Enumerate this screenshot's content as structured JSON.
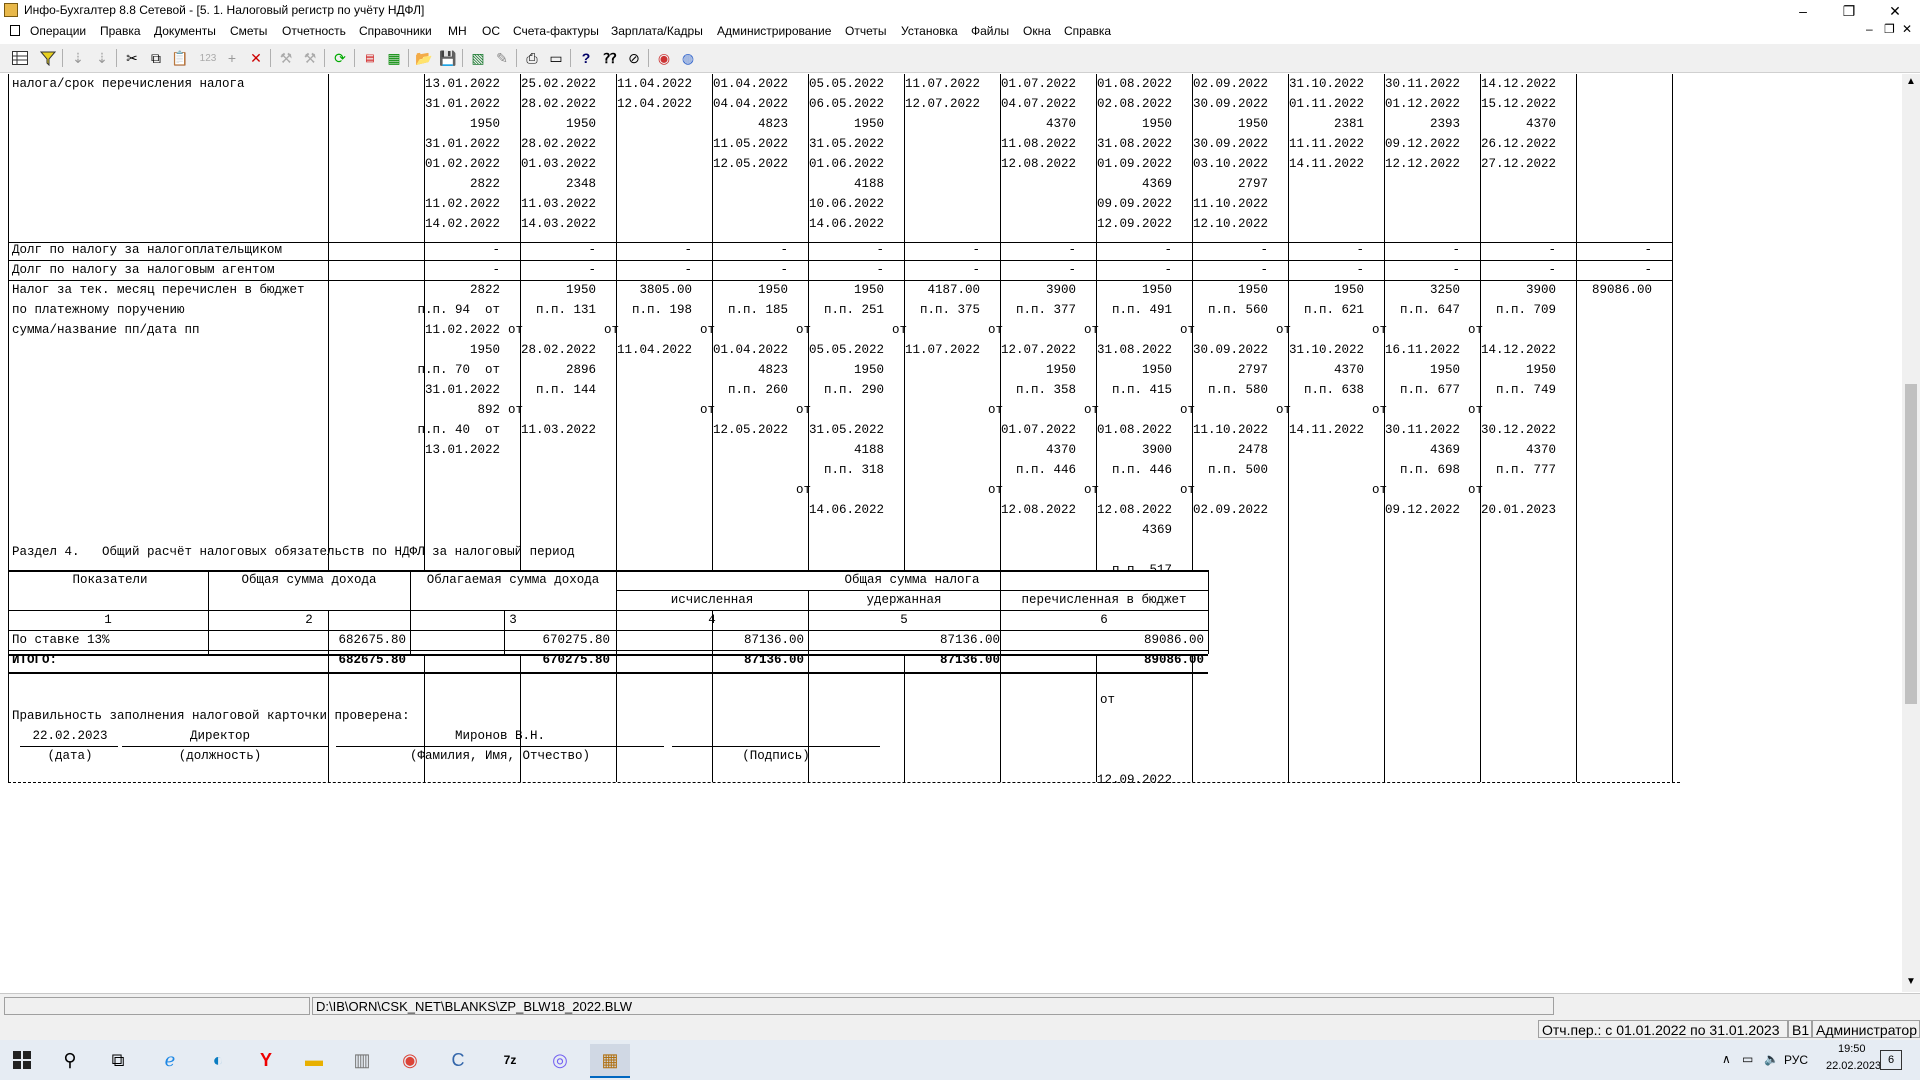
{
  "window": {
    "title": "Инфо-Бухгалтер 8.8 Сетевой - [5. 1. Налоговый регистр по учёту НДФЛ]",
    "min": "–",
    "max": "❐",
    "close": "✕"
  },
  "menu": [
    "Операции",
    "Правка",
    "Документы",
    "Сметы",
    "Отчетность",
    "Справочники",
    "МН",
    "ОС",
    "Счета-фактуры",
    "Зарплата/Кадры",
    "Администрирование",
    "Отчеты",
    "Установка",
    "Файлы",
    "Окна",
    "Справка"
  ],
  "toolbar_icons": [
    "grid-icon",
    "filter-icon",
    "sort-asc-icon",
    "sort-desc-icon",
    "cut-icon",
    "copy-icon",
    "paste-icon",
    "numbering-icon",
    "add-icon",
    "delete-icon",
    "tool-icon",
    "tool2-icon",
    "refresh-icon",
    "pdf-icon",
    "calculator-icon",
    "open-folder-icon",
    "save-icon",
    "excel-icon",
    "edit-icon",
    "print-icon",
    "preview-icon",
    "help-icon",
    "context-help-icon",
    "compass-icon",
    "chrome-icon",
    "web-icon"
  ],
  "doc": {
    "row_due_label": "налога/срок перечисления налога",
    "due_columns": [
      [
        "13.01.2022",
        "31.01.2022",
        "1950",
        "31.01.2022",
        "01.02.2022",
        "2822",
        "11.02.2022",
        "14.02.2022"
      ],
      [
        "25.02.2022",
        "28.02.2022",
        "1950",
        "28.02.2022",
        "01.03.2022",
        "2348",
        "11.03.2022",
        "14.03.2022"
      ],
      [
        "11.04.2022",
        "12.04.2022"
      ],
      [
        "01.04.2022",
        "04.04.2022",
        "4823",
        "11.05.2022",
        "12.05.2022"
      ],
      [
        "05.05.2022",
        "06.05.2022",
        "1950",
        "31.05.2022",
        "01.06.2022",
        "4188",
        "10.06.2022",
        "14.06.2022"
      ],
      [
        "11.07.2022",
        "12.07.2022"
      ],
      [
        "01.07.2022",
        "04.07.2022",
        "4370",
        "11.08.2022",
        "12.08.2022"
      ],
      [
        "01.08.2022",
        "02.08.2022",
        "1950",
        "31.08.2022",
        "01.09.2022",
        "4369",
        "09.09.2022",
        "12.09.2022"
      ],
      [
        "02.09.2022",
        "30.09.2022",
        "1950",
        "30.09.2022",
        "03.10.2022",
        "2797",
        "11.10.2022",
        "12.10.2022"
      ],
      [
        "31.10.2022",
        "01.11.2022",
        "2381",
        "11.11.2022",
        "14.11.2022"
      ],
      [
        "30.11.2022",
        "01.12.2022",
        "2393",
        "09.12.2022",
        "12.12.2022"
      ],
      [
        "14.12.2022",
        "15.12.2022",
        "4370",
        "26.12.2022",
        "27.12.2022"
      ]
    ],
    "debt_taxpayer": "Долг по налогу за налогоплательщиком",
    "debt_agent": "Долг по налогу за налоговым агентом",
    "dash": "-",
    "paid_label": [
      "Налог за тек. месяц перечислен в бюджет",
      "по платежному поручению",
      "сумма/название пп/дата пп"
    ],
    "paid_columns": [
      [
        "2822",
        "п.п. 94  от",
        "11.02.2022",
        "1950",
        "п.п. 70  от",
        "31.01.2022",
        "892",
        "п.п. 40  от",
        "13.01.2022"
      ],
      [
        "1950",
        "п.п. 131",
        "от",
        "28.02.2022",
        "2896",
        "п.п. 144",
        "от",
        "11.03.2022"
      ],
      [
        "3805.00",
        "п.п. 198",
        "от",
        "11.04.2022"
      ],
      [
        "1950",
        "п.п. 185",
        "от",
        "01.04.2022",
        "4823",
        "п.п. 260",
        "от",
        "12.05.2022"
      ],
      [
        "1950",
        "п.п. 251",
        "от",
        "05.05.2022",
        "1950",
        "п.п. 290",
        "от",
        "31.05.2022",
        "4188",
        "п.п. 318",
        "от",
        "14.06.2022"
      ],
      [
        "4187.00",
        "п.п. 375",
        "от",
        "11.07.2022"
      ],
      [
        "3900",
        "п.п. 377",
        "от",
        "12.07.2022",
        "1950",
        "п.п. 358",
        "от",
        "01.07.2022",
        "4370",
        "п.п. 446",
        "от",
        "12.08.2022"
      ],
      [
        "1950",
        "п.п. 491",
        "от",
        "31.08.2022",
        "1950",
        "п.п. 415",
        "от",
        "01.08.2022",
        "3900",
        "п.п. 446",
        "от",
        "12.08.2022",
        "4369",
        "",
        "п.п. 517"
      ],
      [
        "1950",
        "п.п. 560",
        "от",
        "30.09.2022",
        "2797",
        "п.п. 580",
        "от",
        "11.10.2022",
        "2478",
        "п.п. 500",
        "от",
        "02.09.2022"
      ],
      [
        "1950",
        "п.п. 621",
        "от",
        "31.10.2022",
        "4370",
        "п.п. 638",
        "от",
        "14.11.2022"
      ],
      [
        "3250",
        "п.п. 647",
        "от",
        "16.11.2022",
        "1950",
        "п.п. 677",
        "от",
        "30.11.2022",
        "4369",
        "п.п. 698",
        "от",
        "09.12.2022"
      ],
      [
        "3900",
        "п.п. 709",
        "от",
        "14.12.2022",
        "1950",
        "п.п. 749",
        "от",
        "30.12.2022",
        "4370",
        "п.п. 777",
        "от",
        "20.01.2023"
      ]
    ],
    "paid_total": "89086.00",
    "section4_title": "Раздел 4.   Общий расчёт налоговых обязательств по НДФЛ за налоговый период",
    "s4": {
      "h_indicators": "Показатели",
      "h_income": "Общая сумма дохода",
      "h_taxable": "Облагаемая сумма дохода",
      "h_tax": "Общая сумма налога",
      "h_calc": "исчисленная",
      "h_withheld": "удержанная",
      "h_paid": "перечисленная в бюджет",
      "nums": [
        "1",
        "2",
        "3",
        "4",
        "5",
        "6"
      ],
      "row1": {
        "label": "По ставке 13%",
        "income": "682675.80",
        "taxable": "670275.80",
        "calc": "87136.00",
        "withheld": "87136.00",
        "paid": "89086.00"
      },
      "total": {
        "label": "ИТОГО:",
        "income": "682675.80",
        "taxable": "670275.80",
        "calc": "87136.00",
        "withheld": "87136.00",
        "paid": "89086.00"
      }
    },
    "after_ot": "от",
    "after_date": "12.09.2022",
    "checked": "Правильность заполнения налоговой карточки проверена:",
    "sign_date": "22.02.2023",
    "sign_position": "Директор",
    "sign_name": "Миронов В.Н.",
    "cap_date": "(дата)",
    "cap_position": "(должность)",
    "cap_name": "(Фамилия, Имя, Отчество)",
    "cap_sign": "(Подпись)"
  },
  "status": {
    "path": "D:\\IB\\ORN\\CSK_NET\\BLANKS\\ZP_BLW18_2022.BLW",
    "period": "Отч.пер.: с 01.01.2022 по 31.01.2023",
    "code": "В1",
    "user": "Администратор"
  },
  "taskbar": {
    "lang": "РУС",
    "time": "19:50",
    "date": "22.02.2023",
    "notif": "6"
  }
}
